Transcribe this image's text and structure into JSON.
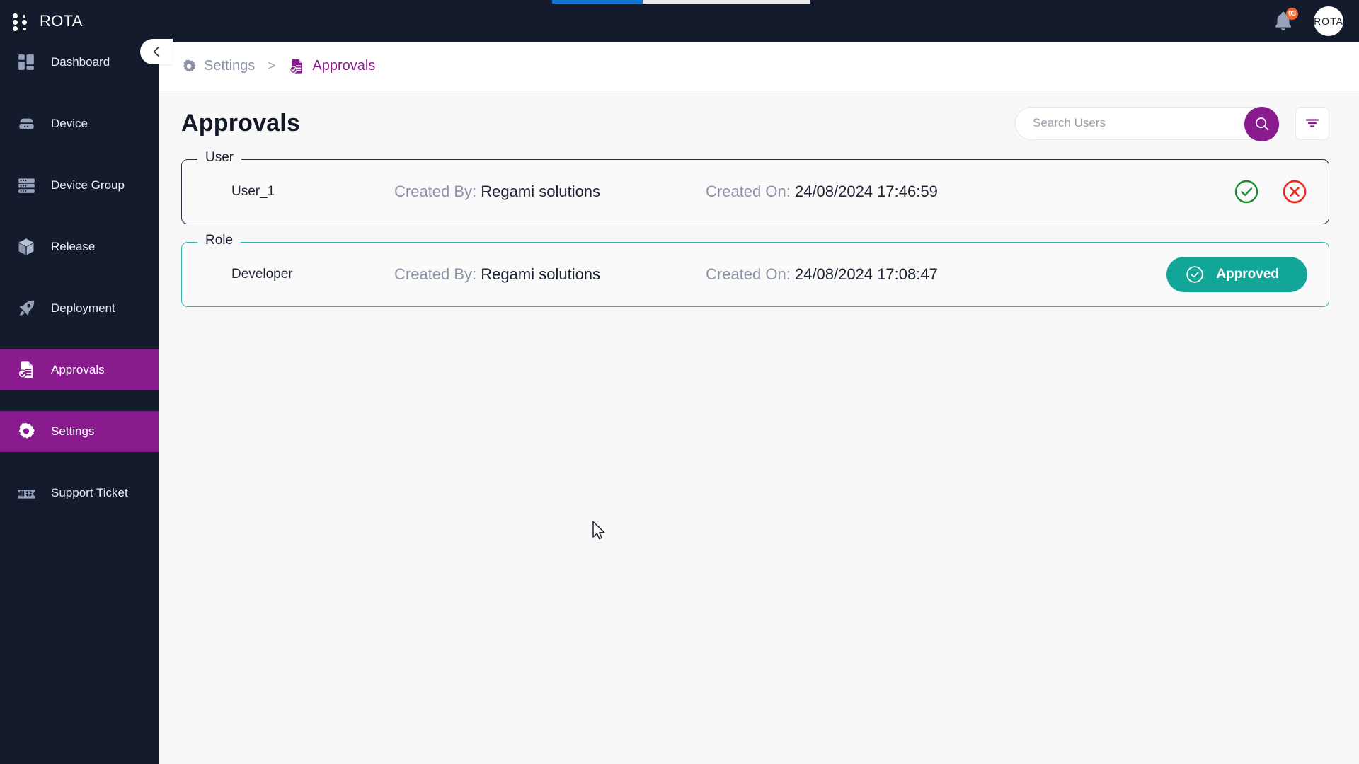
{
  "app": {
    "brand": "ROTA",
    "logo_icon": "grid-dots-icon",
    "avatar_initials": "ROTA",
    "notification_count": "03",
    "notification_icon": "bell-icon",
    "progress_percent": 35,
    "accent_purple": "#8a1b8e",
    "accent_teal": "#12a699",
    "sidebar_bg": "#141b2d",
    "badge_orange": "#f4622a",
    "progress_blue": "#1275d1"
  },
  "sidebar": {
    "collapse_icon": "chevron-left-icon",
    "items": [
      {
        "label": "Dashboard",
        "icon": "dashboard-icon",
        "active": false
      },
      {
        "label": "Device",
        "icon": "device-icon",
        "active": false
      },
      {
        "label": "Device Group",
        "icon": "device-group-icon",
        "active": false
      },
      {
        "label": "Release",
        "icon": "release-box-icon",
        "active": false
      },
      {
        "label": "Deployment",
        "icon": "rocket-icon",
        "active": false
      },
      {
        "label": "Approvals",
        "icon": "approvals-icon",
        "active": true
      },
      {
        "label": "Settings",
        "icon": "gear-icon",
        "active": true
      },
      {
        "label": "Support Ticket",
        "icon": "support-ticket-icon",
        "active": false
      }
    ]
  },
  "breadcrumb": {
    "parent": {
      "label": "Settings",
      "icon": "gear-icon"
    },
    "separator": ">",
    "current": {
      "label": "Approvals",
      "icon": "approvals-icon"
    }
  },
  "page": {
    "title": "Approvals"
  },
  "search": {
    "placeholder": "Search Users",
    "value": "",
    "button_icon": "search-icon",
    "filter_icon": "filter-icon"
  },
  "cards": [
    {
      "legend": "User",
      "name": "User_1",
      "created_by_label": "Created By:",
      "created_by_value": "Regami solutions",
      "created_on_label": "Created On:",
      "created_on_value": "24/08/2024 17:46:59",
      "border_color": "#2a2f3d",
      "actions": [
        {
          "type": "approve",
          "icon": "check-circle-icon",
          "color": "#1a8a2e"
        },
        {
          "type": "reject",
          "icon": "x-circle-icon",
          "color": "#ef2b20"
        }
      ]
    },
    {
      "legend": "Role",
      "name": "Developer",
      "created_by_label": "Created By:",
      "created_by_value": "Regami solutions",
      "created_on_label": "Created On:",
      "created_on_value": "24/08/2024 17:08:47",
      "border_color": "#37b3ae",
      "status_button": {
        "label": "Approved",
        "icon": "check-circle-icon",
        "color": "#12a699"
      }
    }
  ]
}
